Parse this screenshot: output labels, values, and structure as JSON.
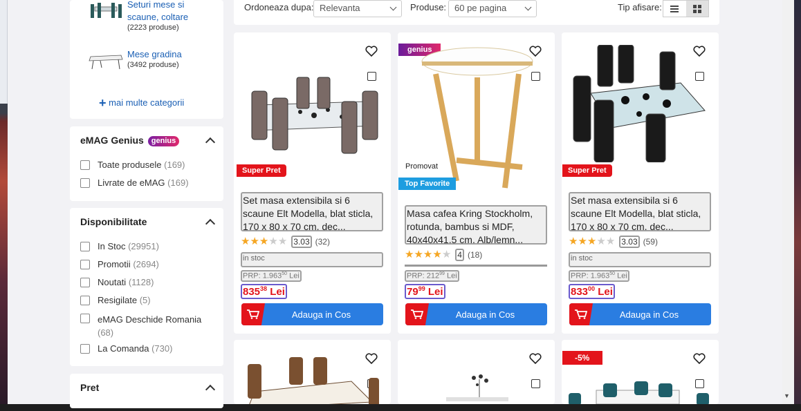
{
  "categories": [
    {
      "name_line1": "Seturi mese si",
      "name_line2": "scaune, coltare",
      "count": "(2223 produse)"
    },
    {
      "name_line1": "Mese gradina",
      "name_line2": "",
      "count": "(3492 produse)"
    }
  ],
  "more_categories": "mai multe categorii",
  "genius_filter": {
    "title": "eMAG Genius",
    "badge": "genius",
    "options": [
      {
        "label": "Toate produsele",
        "count": "(169)"
      },
      {
        "label": "Livrate de eMAG",
        "count": "(169)"
      }
    ]
  },
  "availability_filter": {
    "title": "Disponibilitate",
    "options": [
      {
        "label": "In Stoc",
        "count": "(29951)"
      },
      {
        "label": "Promotii",
        "count": "(2694)"
      },
      {
        "label": "Noutati",
        "count": "(1128)"
      },
      {
        "label": "Resigilate",
        "count": "(5)"
      },
      {
        "label": "eMAG Deschide Romania",
        "count": "(68)"
      },
      {
        "label": "La Comanda",
        "count": "(730)"
      }
    ]
  },
  "price_filter": {
    "title": "Pret"
  },
  "toolbar": {
    "sort_label": "Ordoneaza dupa:",
    "sort_value": "Relevanta",
    "per_page_label": "Produse:",
    "per_page_value": "60 pe pagina",
    "view_label": "Tip afisare:"
  },
  "products": [
    {
      "badge": "Super Pret",
      "title": "Set masa extensibila si 6 scaune Elt Modella, blat sticla, 170 x 80 x 70 cm, dec...",
      "rating": 3.03,
      "rating_text": "3.03",
      "reviews": "(32)",
      "stock": "in stoc",
      "prp": "PRP: 1.963",
      "prp_sup": "50",
      "prp_cur": "Lei",
      "price_int": "835",
      "price_dec": "38",
      "currency": "Lei",
      "add_to_cart": "Adauga in Cos"
    },
    {
      "badge_genius": "genius",
      "promovat": "Promovat",
      "badge": "Top Favorite",
      "title": "Masa cafea Kring Stockholm, rotunda, bambus si MDF, 40x40x41.5 cm, Alb/lemn...",
      "rating": 4,
      "rating_text": "4",
      "reviews": "(18)",
      "prp": "PRP: 212",
      "prp_sup": "99",
      "prp_cur": "Lei",
      "price_int": "79",
      "price_dec": "99",
      "currency": "Lei",
      "add_to_cart": "Adauga in Cos"
    },
    {
      "badge": "Super Pret",
      "title": "Set masa extensibila si 6 scaune Elt Modella, blat sticla, 170 x 80 x 70 cm, dec...",
      "rating": 3.03,
      "rating_text": "3.03",
      "reviews": "(59)",
      "stock": "in stoc",
      "prp": "PRP: 1.963",
      "prp_sup": "50",
      "prp_cur": "Lei",
      "price_int": "833",
      "price_dec": "00",
      "currency": "Lei",
      "add_to_cart": "Adauga in Cos"
    }
  ],
  "bottom_row": [
    {
      "badge": ""
    },
    {
      "badge": ""
    },
    {
      "badge": "-5%"
    }
  ],
  "colors": {
    "accent_blue": "#2a7de1",
    "price_red": "#e3141b",
    "link_blue": "#1a5fb4"
  }
}
